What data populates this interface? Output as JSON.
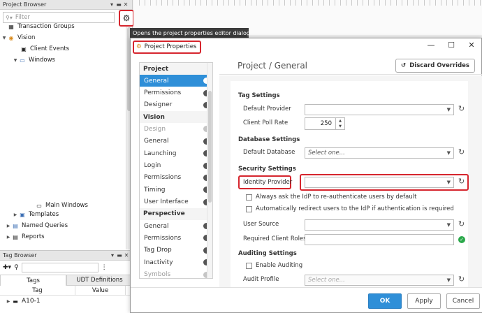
{
  "project_browser": {
    "title": "Project Browser",
    "filter_placeholder": "Filter",
    "tree": [
      {
        "label": "Transaction Groups",
        "icon": "transaction-groups-icon"
      },
      {
        "label": "Vision",
        "icon": "vision-icon"
      },
      {
        "label": "Client Events",
        "icon": "client-events-icon"
      },
      {
        "label": "Windows",
        "icon": "windows-icon"
      },
      {
        "label": "Main Windows",
        "icon": "window-icon"
      },
      {
        "label": "Templates",
        "icon": "templates-icon"
      },
      {
        "label": "Named Queries",
        "icon": "named-queries-icon"
      },
      {
        "label": "Reports",
        "icon": "reports-icon"
      }
    ]
  },
  "tooltip": "Opens the project properties editor dialog",
  "tag_browser": {
    "title": "Tag Browser",
    "tabs": [
      "Tags",
      "UDT Definitions"
    ],
    "columns": [
      "Tag",
      "Value"
    ],
    "rows": [
      {
        "tag": "A10-1"
      }
    ]
  },
  "dialog": {
    "title": "Project Properties",
    "heading": "Project / General",
    "discard_label": "Discard Overrides",
    "nav": [
      {
        "group": "Project",
        "items": [
          "General",
          "Permissions",
          "Designer"
        ]
      },
      {
        "group": "Vision",
        "items": [
          "Design",
          "General",
          "Launching",
          "Login",
          "Permissions",
          "Timing",
          "User Interface"
        ]
      },
      {
        "group": "Perspective",
        "items": [
          "General",
          "Permissions",
          "Tag Drop",
          "Inactivity",
          "Symbols"
        ]
      }
    ],
    "selected": "Project / General",
    "tag_settings": {
      "heading": "Tag Settings",
      "default_provider_label": "Default Provider",
      "client_poll_rate_label": "Client Poll Rate",
      "client_poll_rate_value": "250"
    },
    "database_settings": {
      "heading": "Database Settings",
      "default_database_label": "Default Database",
      "default_database_value": "Select one..."
    },
    "security_settings": {
      "heading": "Security Settings",
      "identity_provider_label": "Identity Provider",
      "check_reauth": "Always ask the IdP to re-authenticate users by default",
      "check_redirect": "Automatically redirect users to the IdP if authentication is required",
      "user_source_label": "User Source",
      "required_roles_label": "Required Client Roles"
    },
    "auditing_settings": {
      "heading": "Auditing Settings",
      "enable_label": "Enable Auditing",
      "audit_profile_label": "Audit Profile",
      "audit_profile_value": "Select one..."
    },
    "buttons": {
      "ok": "OK",
      "apply": "Apply",
      "cancel": "Cancel"
    }
  },
  "colors": {
    "accent": "#2f8fd8",
    "highlight": "#d6262e",
    "ok_green": "#2aa84a"
  }
}
